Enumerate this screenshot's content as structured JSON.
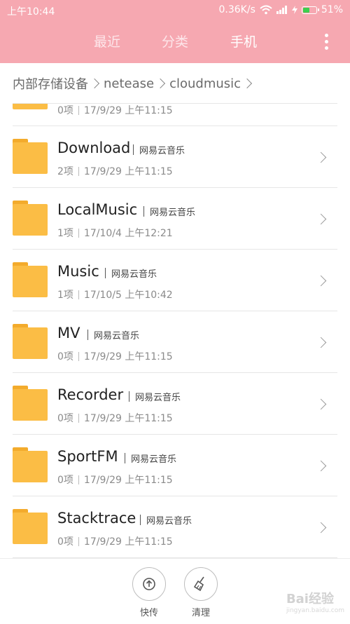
{
  "status": {
    "time": "上午10:44",
    "speed": "0.36K/s",
    "battery": "51%"
  },
  "tabs": [
    {
      "label": "最近"
    },
    {
      "label": "分类"
    },
    {
      "label": "手机"
    }
  ],
  "breadcrumb": [
    "内部存储设备",
    "netease",
    "cloudmusic"
  ],
  "partial_row": {
    "count": "0项",
    "date": "17/9/29 上午11:15"
  },
  "rows": [
    {
      "name": "Download",
      "tag": "网易云音乐",
      "count": "2项",
      "date": "17/9/29 上午11:15"
    },
    {
      "name": "LocalMusic",
      "tag": "网易云音乐",
      "count": "1项",
      "date": "17/10/4 上午12:21"
    },
    {
      "name": "Music",
      "tag": "网易云音乐",
      "count": "1项",
      "date": "17/10/5 上午10:42"
    },
    {
      "name": "MV",
      "tag": "网易云音乐",
      "count": "0项",
      "date": "17/9/29 上午11:15"
    },
    {
      "name": "Recorder",
      "tag": "网易云音乐",
      "count": "0项",
      "date": "17/9/29 上午11:15"
    },
    {
      "name": "SportFM",
      "tag": "网易云音乐",
      "count": "0项",
      "date": "17/9/29 上午11:15"
    },
    {
      "name": "Stacktrace",
      "tag": "网易云音乐",
      "count": "0项",
      "date": "17/9/29 上午11:15"
    }
  ],
  "bottom": {
    "share_label": "快传",
    "clean_label": "清理"
  },
  "colors": {
    "header": "#f6a8b1",
    "folder": "#fbbd45",
    "battery_fill": "#3ccf4e"
  },
  "watermark": {
    "brand": "Bai经验",
    "url": "jingyan.baidu.com"
  }
}
